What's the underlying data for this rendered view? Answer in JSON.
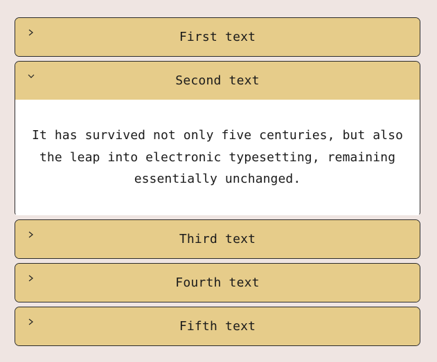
{
  "accordion": {
    "items": [
      {
        "title": "First text",
        "expanded": false
      },
      {
        "title": "Second text",
        "expanded": true,
        "content": "It has survived not only five centuries, but also the leap into electronic typesetting, remaining essentially unchanged."
      },
      {
        "title": "Third text",
        "expanded": false
      },
      {
        "title": "Fourth text",
        "expanded": false
      },
      {
        "title": "Fifth text",
        "expanded": false
      }
    ]
  },
  "colors": {
    "page_background": "#efe5e2",
    "header_background": "#e6cc8a",
    "panel_background": "#ffffff",
    "border": "#2b2b2b"
  },
  "icons": {
    "collapsed": "chevron-right-icon",
    "expanded": "chevron-down-icon"
  }
}
